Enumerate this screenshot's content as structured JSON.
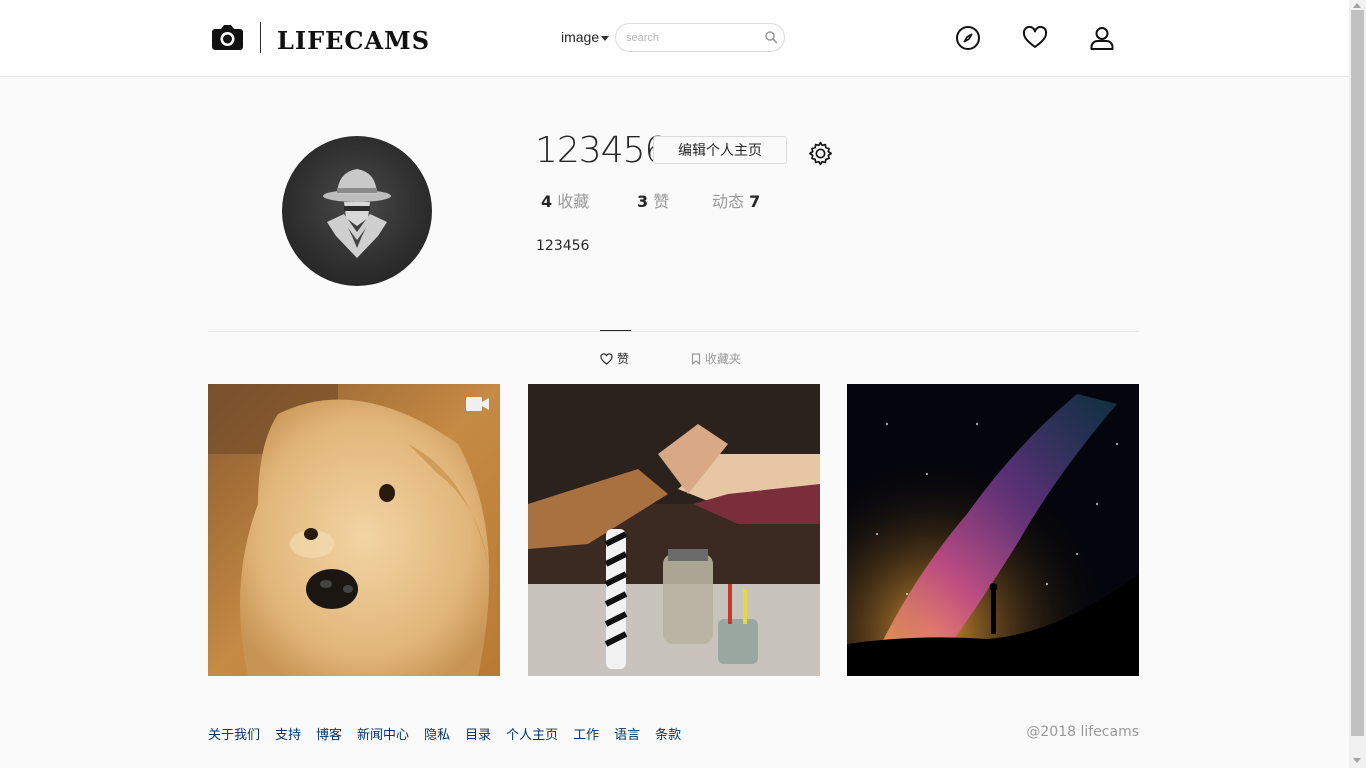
{
  "header": {
    "logo_text": "LIFECAMS",
    "type_select": "image",
    "search_placeholder": "search"
  },
  "profile": {
    "username": "123456",
    "edit_button": "编辑个人主页",
    "stats": {
      "favorites_count": "4",
      "favorites_label": "收藏",
      "likes_count": "3",
      "likes_label": "赞",
      "posts_label": "动态",
      "posts_count": "7"
    },
    "bio": "123456"
  },
  "tabs": {
    "likes": "赞",
    "collections": "收藏夹"
  },
  "footer": {
    "links": [
      "关于我们",
      "支持",
      "博客",
      "新闻中心",
      "隐私",
      "目录",
      "个人主页",
      "工作",
      "语言",
      "条款"
    ],
    "copyright": "@2018 lifecams"
  },
  "icons": {
    "logo": "camera-icon",
    "explore": "compass-icon",
    "activity": "heart-icon",
    "profile": "user-icon",
    "settings": "gear-icon",
    "video": "video-camera-icon"
  }
}
